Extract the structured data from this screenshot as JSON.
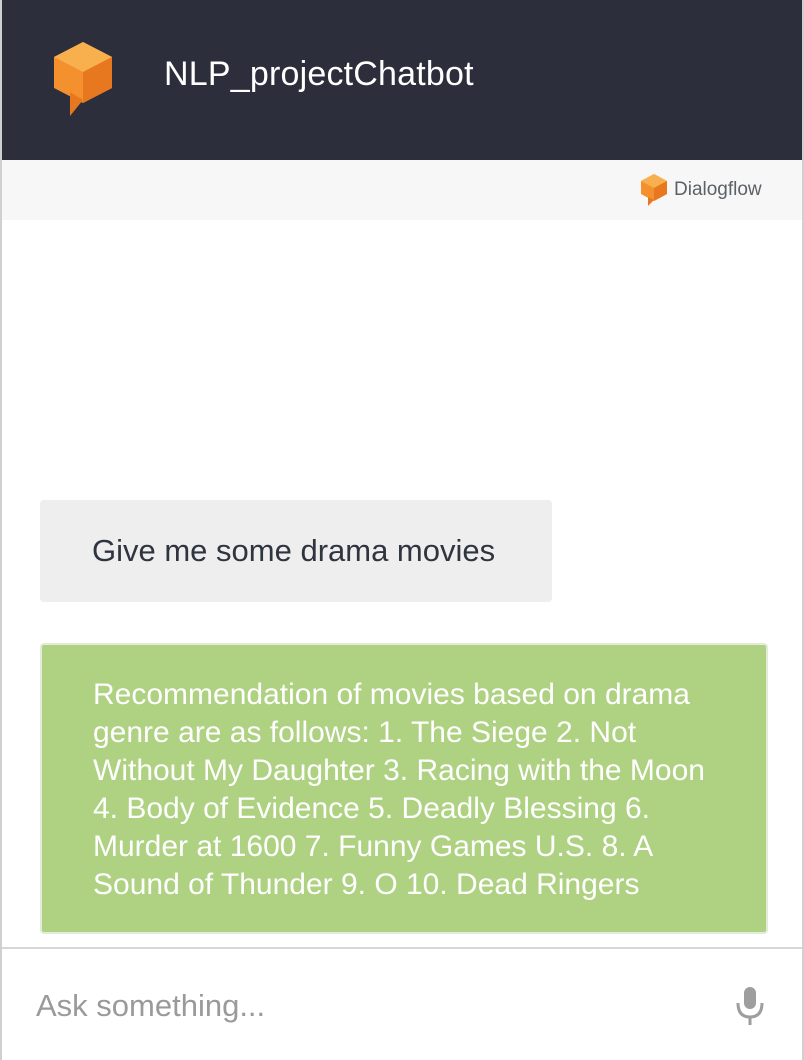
{
  "header": {
    "title": "NLP_projectChatbot",
    "logo_icon": "dialogflow-logo-icon",
    "background_color": "#2c2f3b",
    "logo_colors": [
      "#f6a13a",
      "#e87b25",
      "#f4902d"
    ]
  },
  "brand": {
    "label": "Dialogflow",
    "icon": "dialogflow-logo-icon"
  },
  "messages": [
    {
      "sender": "user",
      "text": "Give me some drama movies",
      "bubble_color": "#eeeeee"
    },
    {
      "sender": "bot",
      "text": "Recommendation of movies based on drama genre are as follows: 1. The Siege 2. Not Without My Daughter 3. Racing with the Moon 4. Body of Evidence 5. Deadly Blessing 6. Murder at 1600 7. Funny Games U.S. 8. A Sound of Thunder 9. O 10. Dead Ringers",
      "bubble_color": "#afd182"
    }
  ],
  "input": {
    "placeholder": "Ask something...",
    "value": "",
    "mic_icon": "microphone-icon"
  }
}
